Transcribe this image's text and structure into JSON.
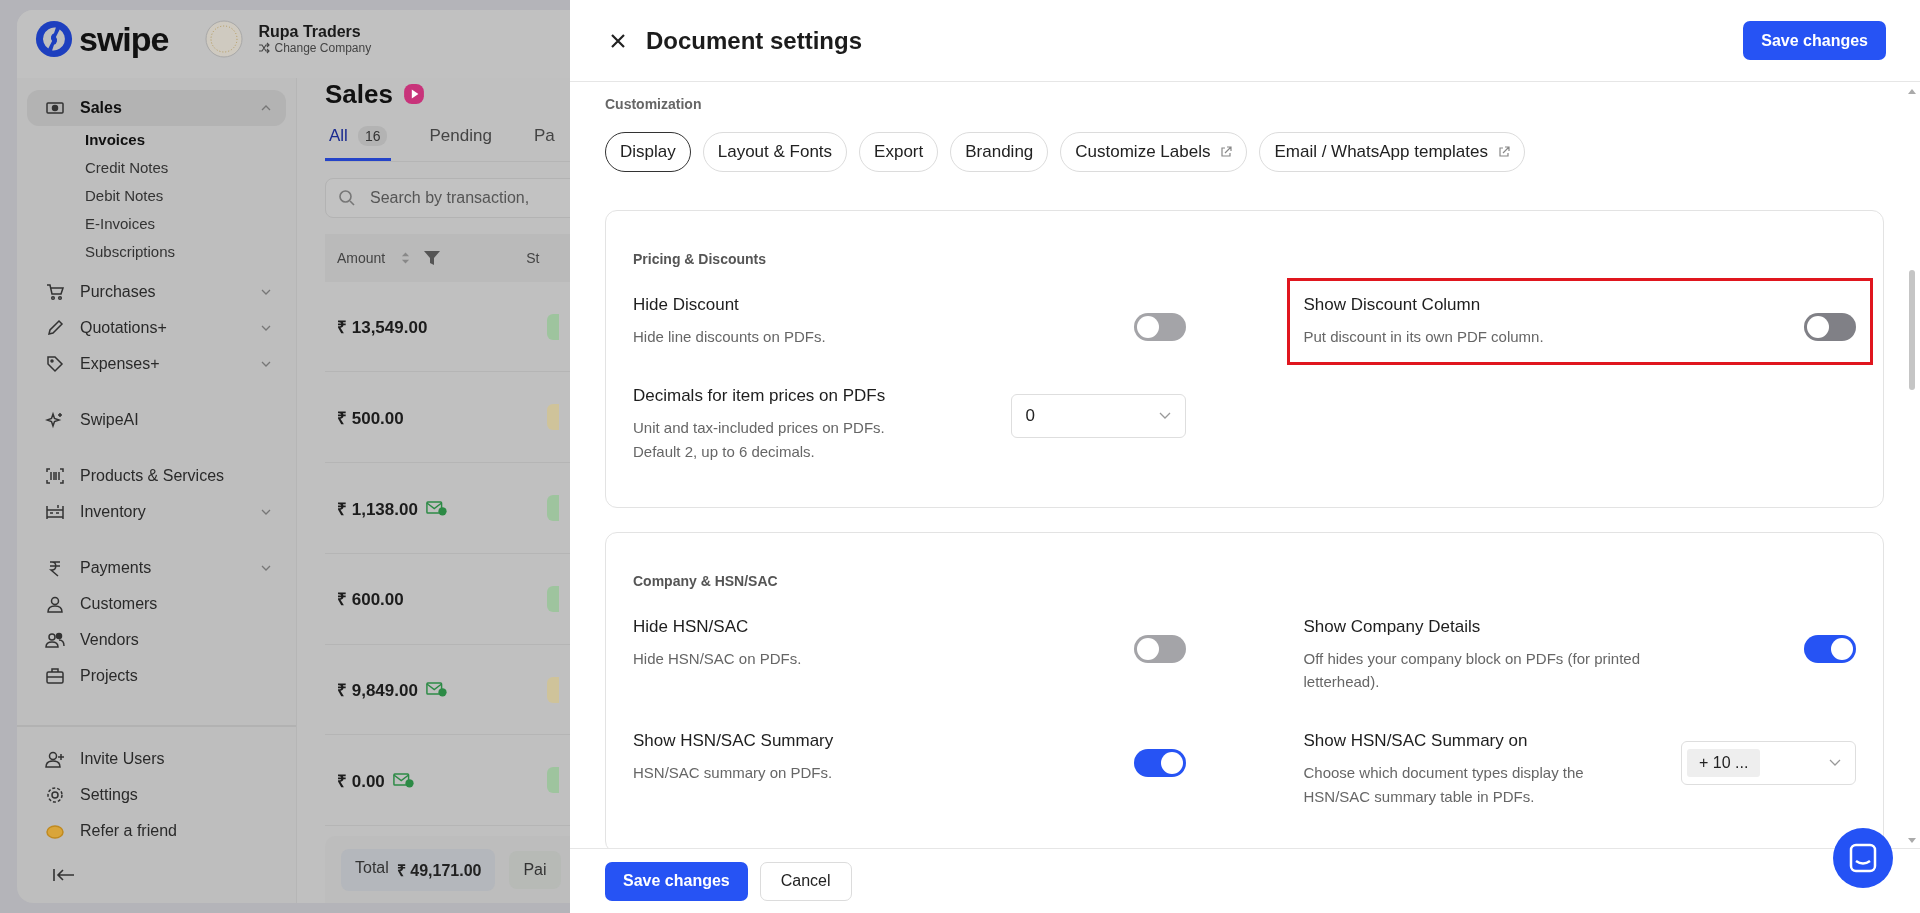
{
  "app": {
    "brand": "swipe",
    "company": {
      "name": "Rupa Traders",
      "action": "Change Company"
    },
    "sidebar": {
      "groups": [
        [
          {
            "label": "Sales",
            "expanded": true,
            "selected": true,
            "children": [
              {
                "label": "Invoices",
                "selected": true
              },
              {
                "label": "Credit Notes",
                "selected": false
              },
              {
                "label": "Debit Notes",
                "selected": false
              },
              {
                "label": "E-Invoices",
                "selected": false
              },
              {
                "label": "Subscriptions",
                "selected": false
              }
            ]
          },
          {
            "label": "Purchases",
            "expanded": false,
            "selected": false
          },
          {
            "label": "Quotations+",
            "expanded": false,
            "selected": false
          },
          {
            "label": "Expenses+",
            "expanded": false,
            "selected": false
          }
        ],
        [
          {
            "label": "SwipeAI",
            "selected": false
          }
        ],
        [
          {
            "label": "Products & Services",
            "selected": false
          },
          {
            "label": "Inventory",
            "expanded": false,
            "selected": false
          }
        ],
        [
          {
            "label": "Payments",
            "expanded": false,
            "selected": false
          },
          {
            "label": "Customers",
            "selected": false
          },
          {
            "label": "Vendors",
            "selected": false
          },
          {
            "label": "Projects",
            "selected": false
          }
        ]
      ],
      "footer_items": [
        {
          "label": "Invite Users"
        },
        {
          "label": "Settings"
        },
        {
          "label": "Refer a friend"
        }
      ]
    },
    "page": {
      "title": "Sales",
      "tabs": [
        {
          "label": "All",
          "count": "16",
          "selected": true
        },
        {
          "label": "Pending",
          "selected": false
        },
        {
          "label": "Pa",
          "selected": false
        }
      ],
      "search": {
        "placeholder": "Search by transaction,"
      },
      "columns": [
        "Amount",
        "St"
      ],
      "rows": [
        {
          "amount": "₹ 13,549.00",
          "emailed": false,
          "color": "#9ec49e"
        },
        {
          "amount": "₹ 500.00",
          "emailed": false,
          "color": "#cfc39a"
        },
        {
          "amount": "₹ 1,138.00",
          "emailed": true,
          "color": "#9ec49e"
        },
        {
          "amount": "₹ 600.00",
          "emailed": false,
          "color": "#9ec49e"
        },
        {
          "amount": "₹ 9,849.00",
          "emailed": true,
          "color": "#cfc39a"
        },
        {
          "amount": "₹ 0.00",
          "emailed": true,
          "color": "#9ec49e"
        }
      ],
      "totals": [
        {
          "label": "Total",
          "value": "₹ 49,171.00"
        },
        {
          "label": "Pai"
        }
      ]
    }
  },
  "drawer": {
    "title": "Document settings",
    "save_label": "Save changes",
    "section_label": "Customization",
    "chips": [
      {
        "label": "Display",
        "selected": true,
        "external": false
      },
      {
        "label": "Layout & Fonts",
        "selected": false,
        "external": false
      },
      {
        "label": "Export",
        "selected": false,
        "external": false
      },
      {
        "label": "Branding",
        "selected": false,
        "external": false
      },
      {
        "label": "Customize Labels",
        "selected": false,
        "external": true
      },
      {
        "label": "Email / WhatsApp templates",
        "selected": false,
        "external": true
      }
    ],
    "cards": [
      {
        "title": "Pricing & Discounts",
        "settings": [
          {
            "kind": "toggle",
            "label": "Hide Discount",
            "description": "Hide line discounts on PDFs.",
            "on": false,
            "highlighted": false
          },
          {
            "kind": "toggle",
            "label": "Show Discount Column",
            "description": "Put discount in its own PDF column.",
            "on": false,
            "highlighted": true
          },
          {
            "kind": "select",
            "label": "Decimals for item prices on PDFs",
            "description": "Unit and tax-included prices on PDFs. Default 2, up to 6 decimals.",
            "value": "0",
            "highlighted": false
          }
        ]
      },
      {
        "title": "Company & HSN/SAC",
        "settings": [
          {
            "kind": "toggle",
            "label": "Hide HSN/SAC",
            "description": "Hide HSN/SAC on PDFs.",
            "on": false,
            "highlighted": false
          },
          {
            "kind": "toggle",
            "label": "Show Company Details",
            "description": "Off hides your company block on PDFs (for printed letterhead).",
            "on": true,
            "highlighted": false
          },
          {
            "kind": "toggle",
            "label": "Show HSN/SAC Summary",
            "description": "HSN/SAC summary on PDFs.",
            "on": true,
            "highlighted": false
          },
          {
            "kind": "multiselect",
            "label": "Show HSN/SAC Summary on",
            "description": "Choose which document types display the HSN/SAC summary table in PDFs.",
            "value": "+ 10 ...",
            "highlighted": false
          }
        ]
      }
    ],
    "footer": {
      "save": "Save changes",
      "cancel": "Cancel"
    }
  }
}
